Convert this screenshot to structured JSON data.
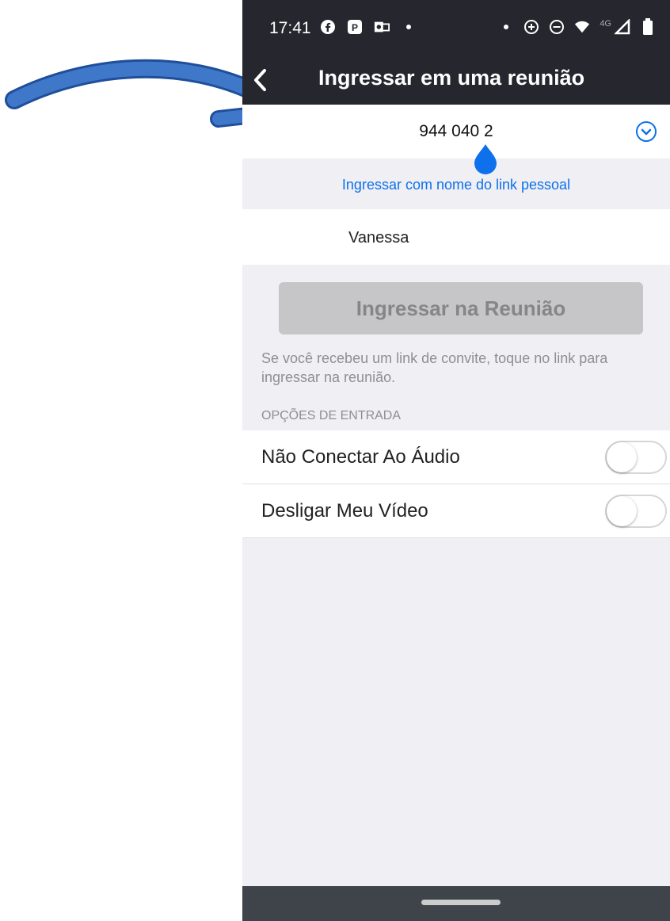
{
  "status_bar": {
    "time": "17:41",
    "network_label": "4G"
  },
  "header": {
    "title": "Ingressar em uma reunião"
  },
  "meeting": {
    "id_value": "944 040 2"
  },
  "link_option": {
    "label": "Ingressar com nome do link pessoal"
  },
  "user": {
    "name": "Vanessa"
  },
  "join_button": {
    "label": "Ingressar na Reunião"
  },
  "hint": {
    "text": "Se você recebeu um link de convite, toque no link para ingressar na reunião."
  },
  "options": {
    "section_title": "OPÇÕES DE ENTRADA",
    "items": [
      {
        "label": "Não Conectar Ao Áudio",
        "enabled": false
      },
      {
        "label": "Desligar Meu Vídeo",
        "enabled": false
      }
    ]
  },
  "colors": {
    "header_bg": "#26262e",
    "link_blue": "#0e71eb",
    "arrow_blue": "#3f78c9",
    "disabled_button": "#c6c6c8"
  }
}
